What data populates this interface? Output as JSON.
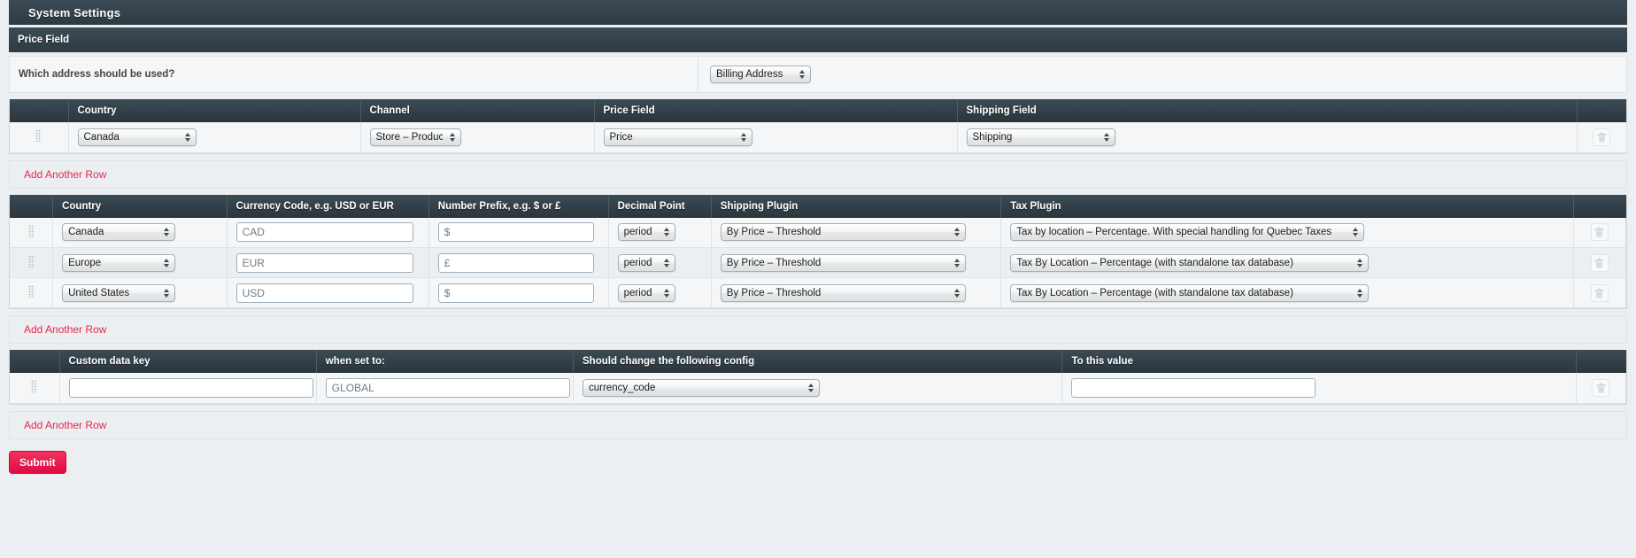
{
  "window": {
    "title": "System Settings",
    "section_title": "Price Field"
  },
  "address": {
    "label": "Which address should be used?",
    "selected": "Billing Address"
  },
  "price_field_table": {
    "headers": [
      "",
      "Country",
      "Channel",
      "Price Field",
      "Shipping Field",
      ""
    ],
    "rows": [
      {
        "country": "Canada",
        "channel": "Store – Products",
        "price_field": "Price",
        "shipping_field": "Shipping"
      }
    ],
    "add_row_label": "Add Another Row"
  },
  "currency_table": {
    "headers": [
      "",
      "Country",
      "Currency Code, e.g. USD or EUR",
      "Number Prefix, e.g. $ or £",
      "Decimal Point",
      "Shipping Plugin",
      "Tax Plugin",
      ""
    ],
    "rows": [
      {
        "country": "Canada",
        "currency_code": "CAD",
        "number_prefix": "$",
        "decimal_point": "period",
        "shipping_plugin": "By Price – Threshold",
        "tax_plugin": "Tax by location – Percentage. With special handling for Quebec Taxes"
      },
      {
        "country": "Europe",
        "currency_code": "EUR",
        "number_prefix": "£",
        "decimal_point": "period",
        "shipping_plugin": "By Price – Threshold",
        "tax_plugin": "Tax By Location – Percentage (with standalone tax database)"
      },
      {
        "country": "United States",
        "currency_code": "USD",
        "number_prefix": "$",
        "decimal_point": "period",
        "shipping_plugin": "By Price – Threshold",
        "tax_plugin": "Tax By Location – Percentage (with standalone tax database)"
      }
    ],
    "add_row_label": "Add Another Row"
  },
  "custom_data_table": {
    "headers": [
      "",
      "Custom data key",
      "when set to:",
      "Should change the following config",
      "To this value",
      ""
    ],
    "rows": [
      {
        "custom_data_key": "",
        "when_set_to": "GLOBAL",
        "config": "currency_code",
        "to_this_value": ""
      }
    ],
    "add_row_label": "Add Another Row"
  },
  "footer": {
    "submit_label": "Submit"
  },
  "colors": {
    "header_dark": "#2f3a42",
    "accent_red": "#e8274b",
    "page_bg": "#eceff1",
    "row_bg": "#f4f6f7"
  },
  "icons": {
    "drag_handle": "drag-handle-icon",
    "delete": "trash-icon",
    "select_arrows": "updown-arrows-icon"
  }
}
